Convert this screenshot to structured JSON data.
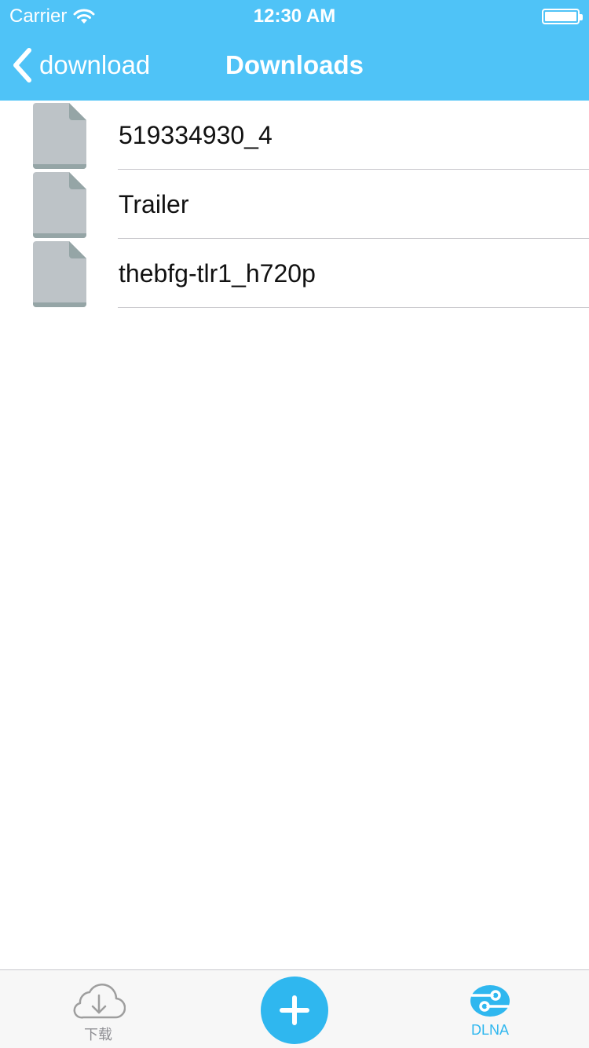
{
  "status_bar": {
    "carrier": "Carrier",
    "time": "12:30 AM"
  },
  "nav": {
    "back_label": "download",
    "title": "Downloads"
  },
  "files": [
    {
      "name": "519334930_4",
      "icon": "file-icon"
    },
    {
      "name": "Trailer",
      "icon": "file-icon"
    },
    {
      "name": "thebfg-tlr1_h720p",
      "icon": "file-icon"
    }
  ],
  "tabbar": {
    "download_label": "下载",
    "add_icon": "plus-icon",
    "dlna_label": "DLNA"
  },
  "colors": {
    "nav_background": "#4fc3f7",
    "accent": "#2fb7ef",
    "file_icon": "#bdc3c7",
    "file_fold": "#95a5a6"
  }
}
